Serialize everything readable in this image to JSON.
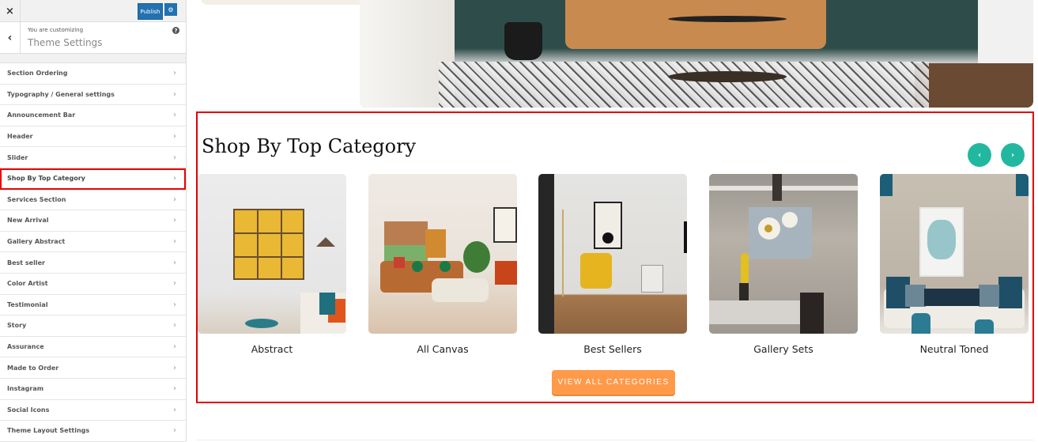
{
  "sidebar": {
    "close_icon": "×",
    "publish_label": "Publish",
    "gear_icon": "⚙",
    "back_icon": "‹",
    "customizing_label": "You are customizing",
    "title": "Theme Settings",
    "help_icon": "?",
    "items": [
      {
        "label": "Section Ordering"
      },
      {
        "label": "Typography / General settings"
      },
      {
        "label": "Announcement Bar"
      },
      {
        "label": "Header"
      },
      {
        "label": "Slider"
      },
      {
        "label": "Shop By Top Category",
        "active": true
      },
      {
        "label": "Services Section"
      },
      {
        "label": "New Arrival"
      },
      {
        "label": "Gallery Abstract"
      },
      {
        "label": "Best seller"
      },
      {
        "label": "Color Artist"
      },
      {
        "label": "Testimonial"
      },
      {
        "label": "Story"
      },
      {
        "label": "Assurance"
      },
      {
        "label": "Made to Order"
      },
      {
        "label": "Instagram"
      },
      {
        "label": "Social Icons"
      },
      {
        "label": "Theme Layout Settings"
      }
    ],
    "chevron": "›"
  },
  "preview": {
    "section_title": "Shop By Top Category",
    "prev_icon": "‹",
    "next_icon": "›",
    "categories": [
      {
        "label": "Abstract"
      },
      {
        "label": "All Canvas"
      },
      {
        "label": "Best Sellers"
      },
      {
        "label": "Gallery Sets"
      },
      {
        "label": "Neutral Toned"
      }
    ],
    "view_all_label": "VIEW ALL CATEGORIES",
    "colors": {
      "accent_teal": "#22b8a0",
      "button_orange": "#fe9a4a",
      "highlight_red": "#e30000",
      "publish_blue": "#2271b1"
    }
  }
}
